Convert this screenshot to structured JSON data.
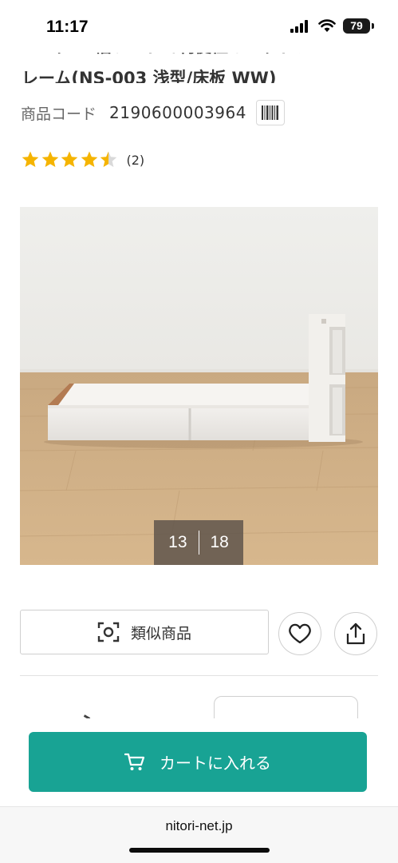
{
  "status_bar": {
    "time": "11:17",
    "battery": "79"
  },
  "product": {
    "title_line1": "シングル 幅ワイドで利便性とべッドフ",
    "title_line2": "レーム(NS-003 浅型/床板 WW)",
    "code_label": "商品コード",
    "code_value": "2190600003964",
    "rating_value": 4.5,
    "rating_max": 5,
    "review_count": "(2)"
  },
  "gallery": {
    "current": "13",
    "total": "18"
  },
  "actions": {
    "similar_label": "類似商品",
    "similar_icon": "scan-icon",
    "favorite_icon": "heart-icon",
    "share_icon": "share-icon"
  },
  "cart": {
    "label": "カートに入れる",
    "icon": "cart-icon"
  },
  "browser": {
    "url": "nitori-net.jp"
  },
  "colors": {
    "accent": "#18a394",
    "star": "#f5b400",
    "text": "#333333",
    "counter_bg": "#5f554b"
  }
}
